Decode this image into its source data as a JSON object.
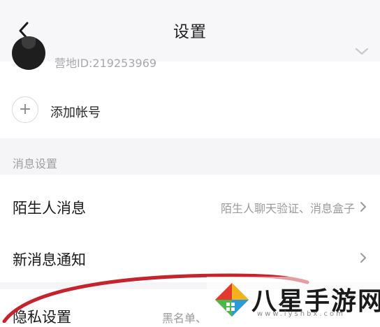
{
  "header": {
    "title": "设置",
    "back_icon": "chevron-left-icon"
  },
  "account": {
    "camp_id": "营地ID:219253969",
    "expand_icon": "chevron-down-icon"
  },
  "add_account": {
    "label": "添加帐号",
    "icon": "plus-icon"
  },
  "message_settings": {
    "section_label": "消息设置",
    "items": [
      {
        "label": "陌生人消息",
        "value": "陌生人聊天验证、消息盒子",
        "icon": "chevron-right-icon"
      },
      {
        "label": "新消息通知",
        "value": "",
        "icon": "chevron-right-icon"
      }
    ]
  },
  "privacy": {
    "label": "隐私设置",
    "value": "黑名单、"
  },
  "watermark": {
    "text": "八星手游网",
    "url": "www.lyshbx.com"
  },
  "colors": {
    "header_bg": "#f7f7f9",
    "section_bg": "#f5f5f7",
    "annotation_red": "#c4242e"
  }
}
